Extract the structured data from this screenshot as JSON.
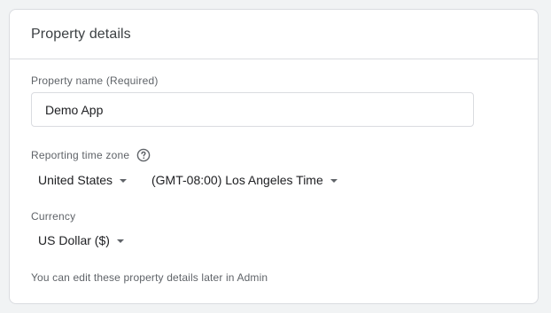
{
  "card": {
    "title": "Property details"
  },
  "property_name": {
    "label": "Property name (Required)",
    "value": "Demo App"
  },
  "time_zone": {
    "label": "Reporting time zone",
    "help_icon": "help-circle-icon",
    "country": "United States",
    "zone": "(GMT-08:00) Los Angeles Time"
  },
  "currency": {
    "label": "Currency",
    "value": "US Dollar ($)"
  },
  "note": "You can edit these property details later in Admin"
}
